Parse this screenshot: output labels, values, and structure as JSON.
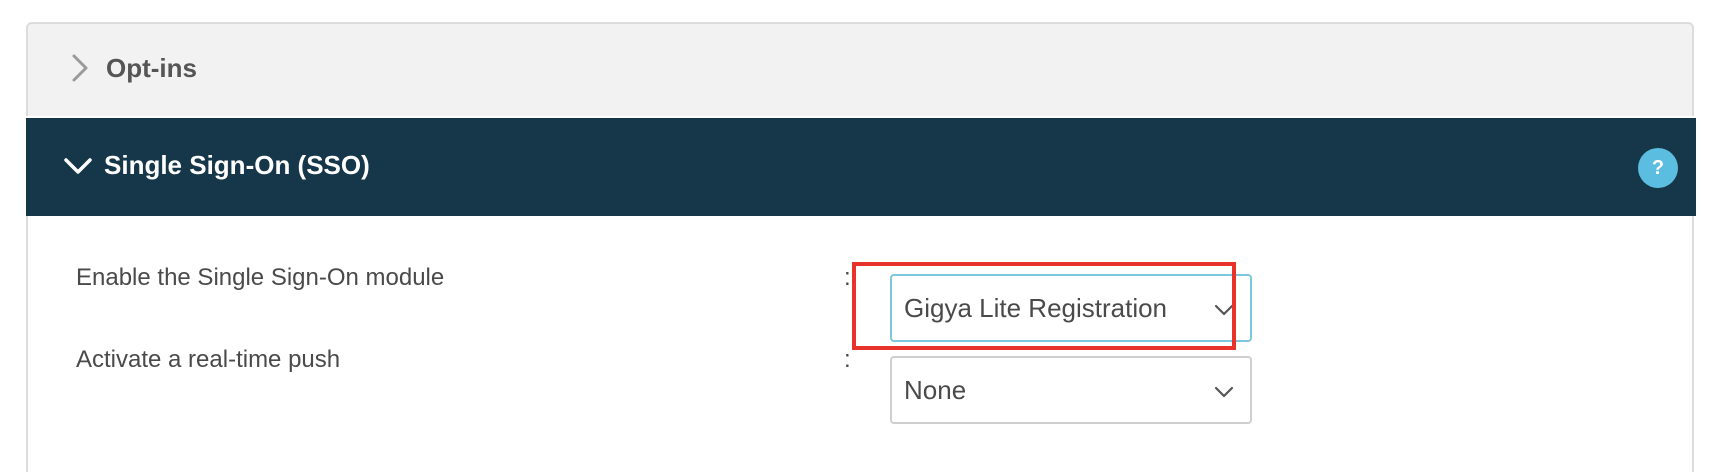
{
  "panels": {
    "optins": {
      "title": "Opt-ins",
      "icon": "chevron-right-icon"
    },
    "sso": {
      "title": "Single Sign-On (SSO)",
      "icon": "chevron-down-icon",
      "help_label": "?",
      "header_color": "#16364a",
      "help_color": "#5bbde0"
    }
  },
  "form": {
    "separator": ":",
    "fields": [
      {
        "label": "Enable the Single Sign-On module",
        "value": "Gigya Lite Registration",
        "highlighted": true
      },
      {
        "label": "Activate a real-time push",
        "value": "None",
        "highlighted": false
      }
    ]
  },
  "annotation": {
    "highlight_color": "#e8332b"
  }
}
